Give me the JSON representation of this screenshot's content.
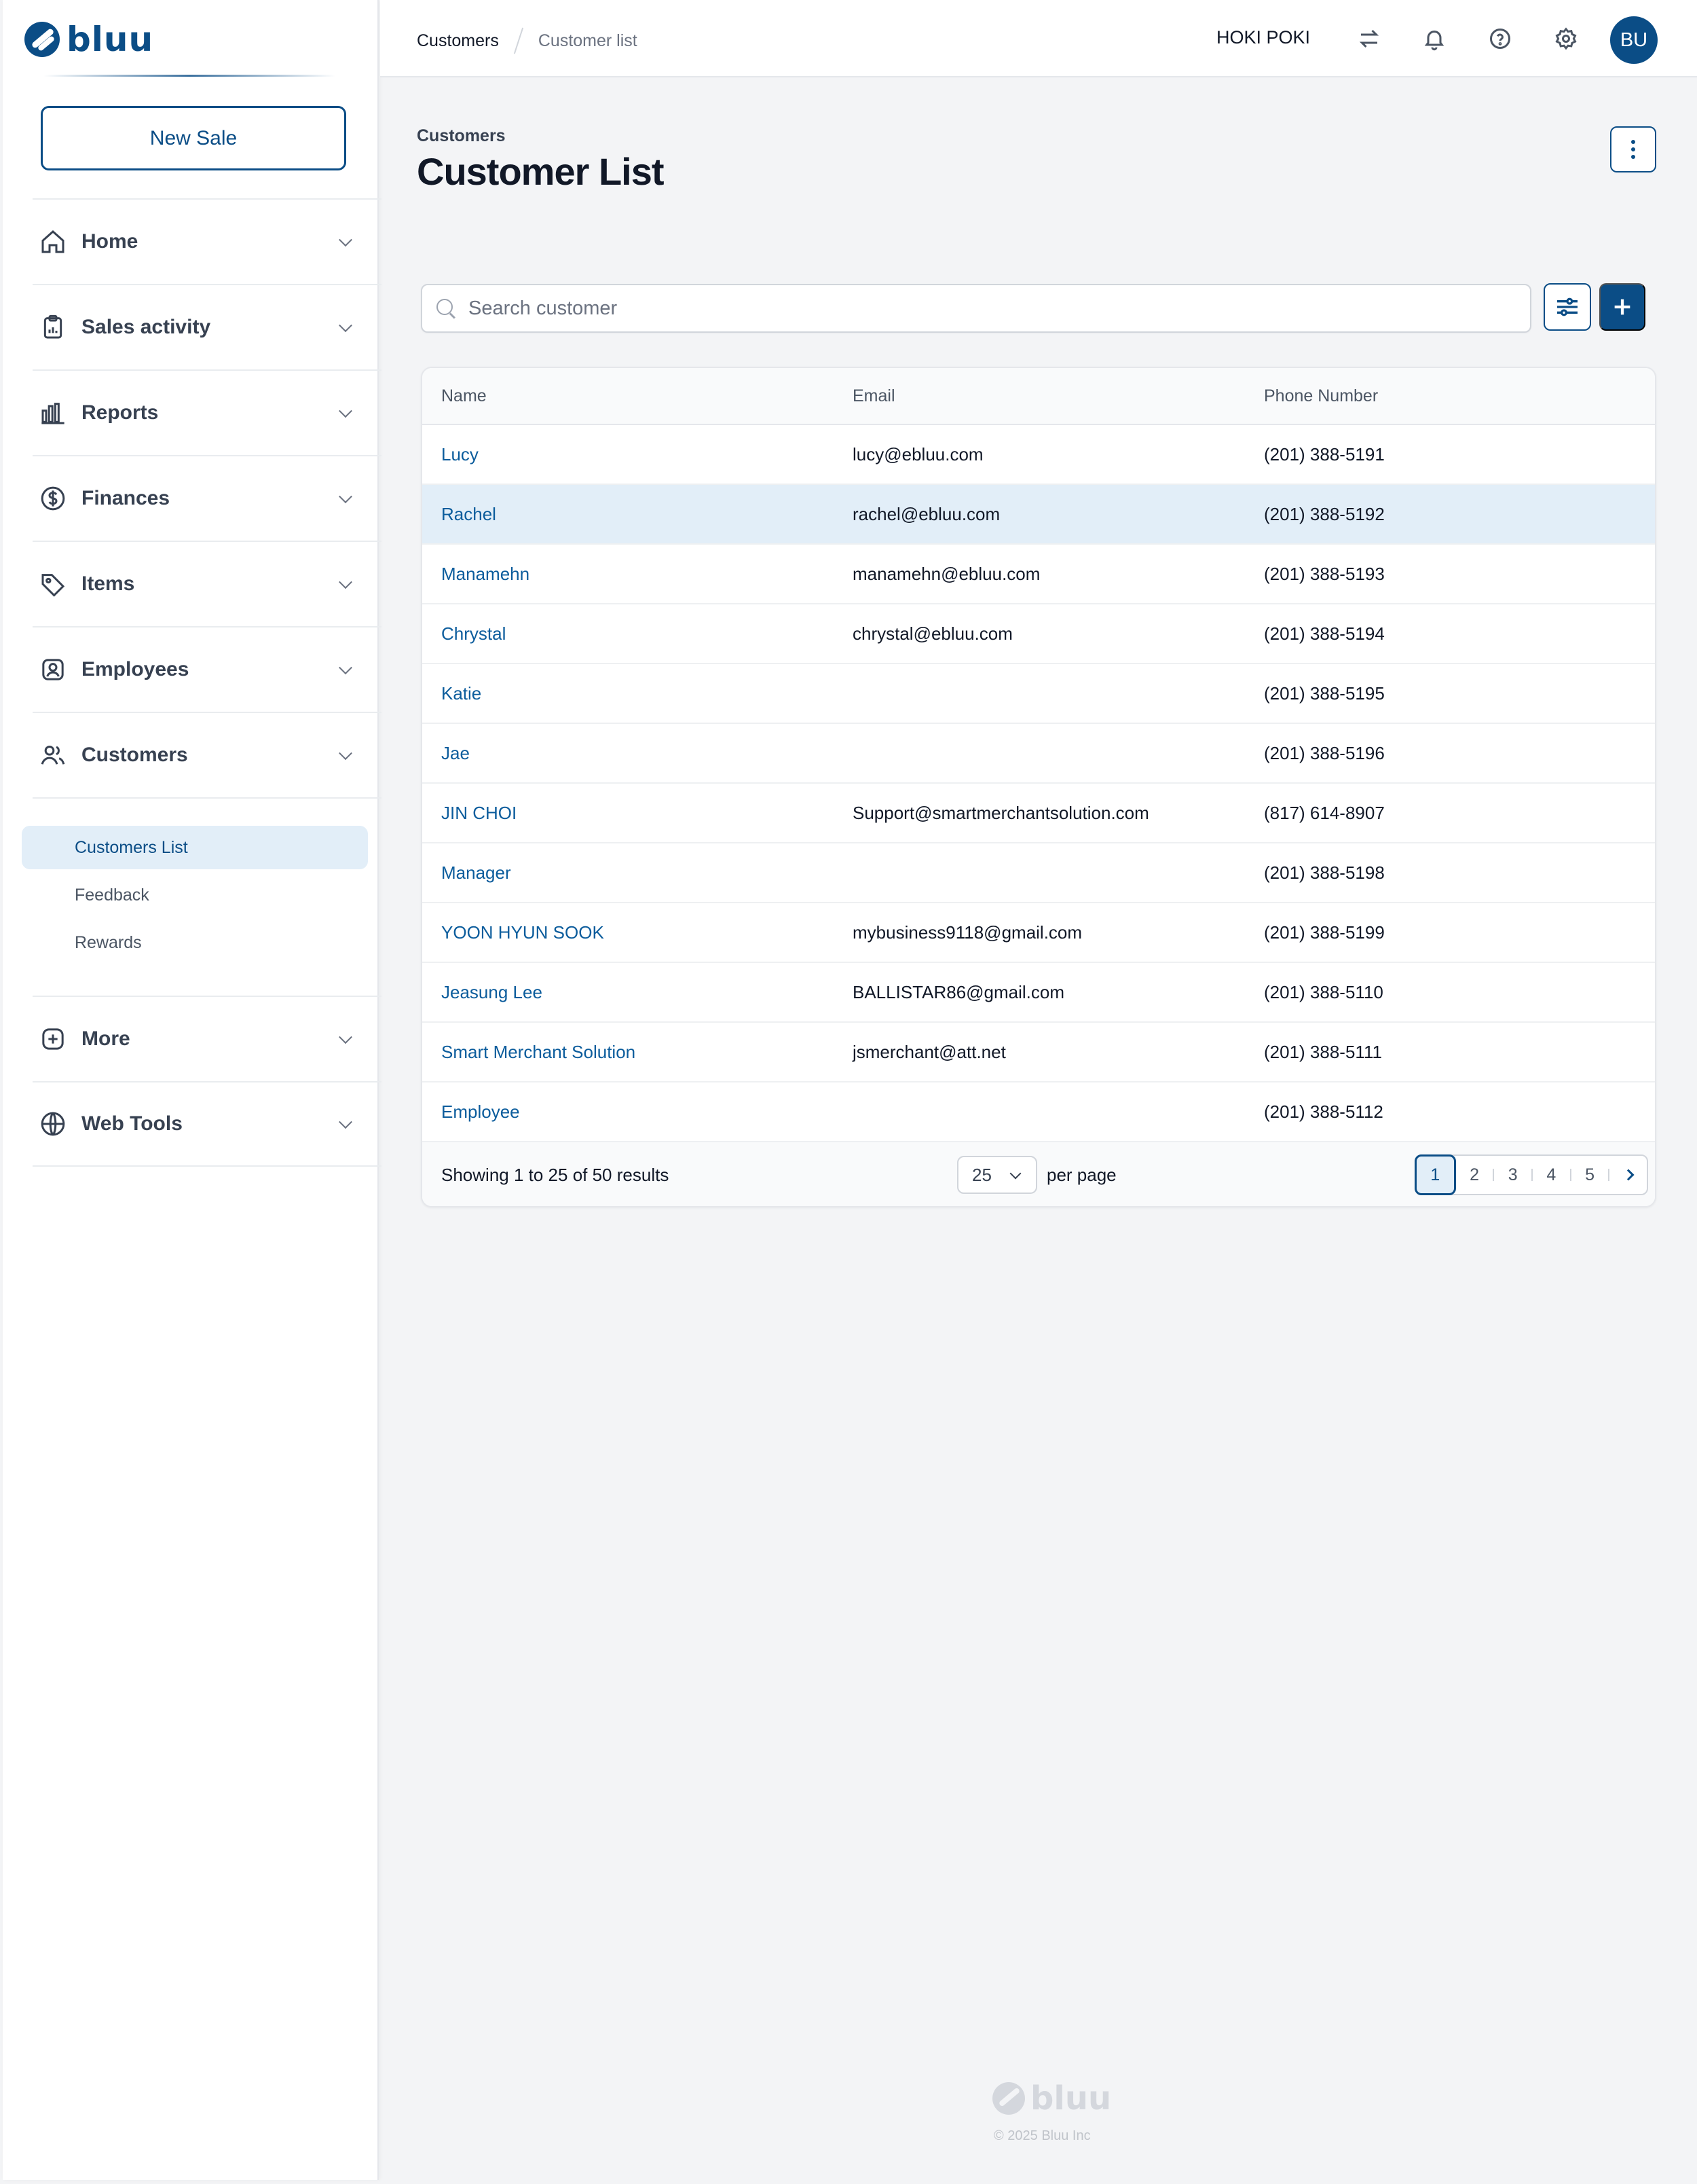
{
  "brand": {
    "name": "bluu",
    "color": "#0b4d86"
  },
  "sidebar": {
    "new_sale_label": "New Sale",
    "items": [
      {
        "label": "Home",
        "icon": "home-icon"
      },
      {
        "label": "Sales activity",
        "icon": "clipboard-icon"
      },
      {
        "label": "Reports",
        "icon": "bar-chart-icon"
      },
      {
        "label": "Finances",
        "icon": "dollar-circle-icon"
      },
      {
        "label": "Items",
        "icon": "tag-icon"
      },
      {
        "label": "Employees",
        "icon": "id-badge-icon"
      },
      {
        "label": "Customers",
        "icon": "users-icon"
      }
    ],
    "customers_sub": [
      {
        "label": "Customers List",
        "active": true
      },
      {
        "label": "Feedback",
        "active": false
      },
      {
        "label": "Rewards",
        "active": false
      }
    ],
    "bottom_items": [
      {
        "label": "More",
        "icon": "plus-square-icon"
      },
      {
        "label": "Web Tools",
        "icon": "globe-icon"
      }
    ]
  },
  "header": {
    "breadcrumb": [
      "Customers",
      "Customer list"
    ],
    "store_name": "HOKI POKI",
    "avatar_initials": "BU",
    "icons": [
      "swap-icon",
      "bell-icon",
      "help-icon",
      "settings-icon"
    ]
  },
  "main": {
    "section_label": "Customers",
    "title": "Customer List",
    "search_placeholder": "Search customer",
    "table": {
      "columns": [
        "Name",
        "Email",
        "Phone Number"
      ],
      "rows": [
        {
          "name": "Lucy",
          "email": "lucy@ebluu.com",
          "phone": "(201) 388-5191"
        },
        {
          "name": "Rachel",
          "email": "rachel@ebluu.com",
          "phone": "(201) 388-5192",
          "selected": true
        },
        {
          "name": "Manamehn",
          "email": "manamehn@ebluu.com",
          "phone": "(201) 388-5193"
        },
        {
          "name": "Chrystal",
          "email": "chrystal@ebluu.com",
          "phone": "(201) 388-5194"
        },
        {
          "name": "Katie",
          "email": "",
          "phone": "(201) 388-5195"
        },
        {
          "name": "Jae",
          "email": "",
          "phone": "(201) 388-5196"
        },
        {
          "name": "JIN CHOI",
          "email": "Support@smartmerchantsolution.com",
          "phone": "(817) 614-8907"
        },
        {
          "name": "Manager",
          "email": "",
          "phone": "(201) 388-5198"
        },
        {
          "name": "YOON HYUN SOOK",
          "email": "mybusiness9118@gmail.com",
          "phone": "(201) 388-5199"
        },
        {
          "name": "Jeasung Lee",
          "email": "BALLISTAR86@gmail.com",
          "phone": "(201) 388-5110"
        },
        {
          "name": "Smart Merchant Solution",
          "email": "jsmerchant@att.net",
          "phone": "(201) 388-5111"
        },
        {
          "name": "Employee",
          "email": "",
          "phone": "(201) 388-5112"
        }
      ]
    },
    "pagination": {
      "showing_text": "Showing 1 to 25 of 50 results",
      "per_page_value": "25",
      "per_page_label": "per page",
      "pages": [
        "1",
        "2",
        "3",
        "4",
        "5"
      ],
      "current_page": "1"
    }
  },
  "footer": {
    "brand": "bluu",
    "copyright": "© 2025 Bluu Inc"
  }
}
